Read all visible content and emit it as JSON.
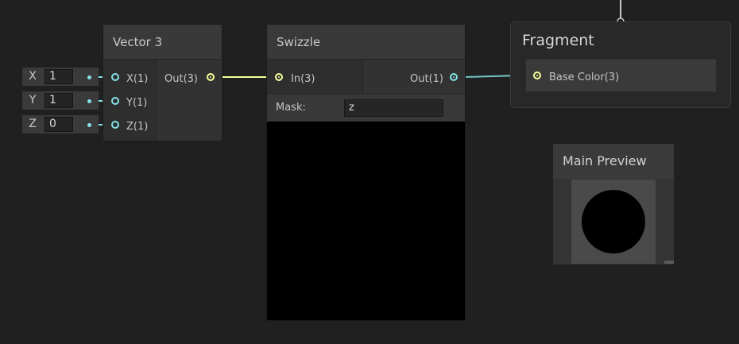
{
  "inline_inputs": [
    {
      "label": "X",
      "value": "1"
    },
    {
      "label": "Y",
      "value": "1"
    },
    {
      "label": "Z",
      "value": "0"
    }
  ],
  "vector3": {
    "title": "Vector 3",
    "inputs": [
      "X(1)",
      "Y(1)",
      "Z(1)"
    ],
    "output": "Out(3)"
  },
  "swizzle": {
    "title": "Swizzle",
    "input": "In(3)",
    "output": "Out(1)",
    "mask_label": "Mask:",
    "mask_value": "z"
  },
  "fragment": {
    "title": "Fragment",
    "port": "Base Color(3)"
  },
  "main_preview": {
    "title": "Main Preview"
  },
  "colors": {
    "vec1_port": "#84e4e7",
    "vec3_port": "#f6ff9a",
    "background": "#202020"
  }
}
